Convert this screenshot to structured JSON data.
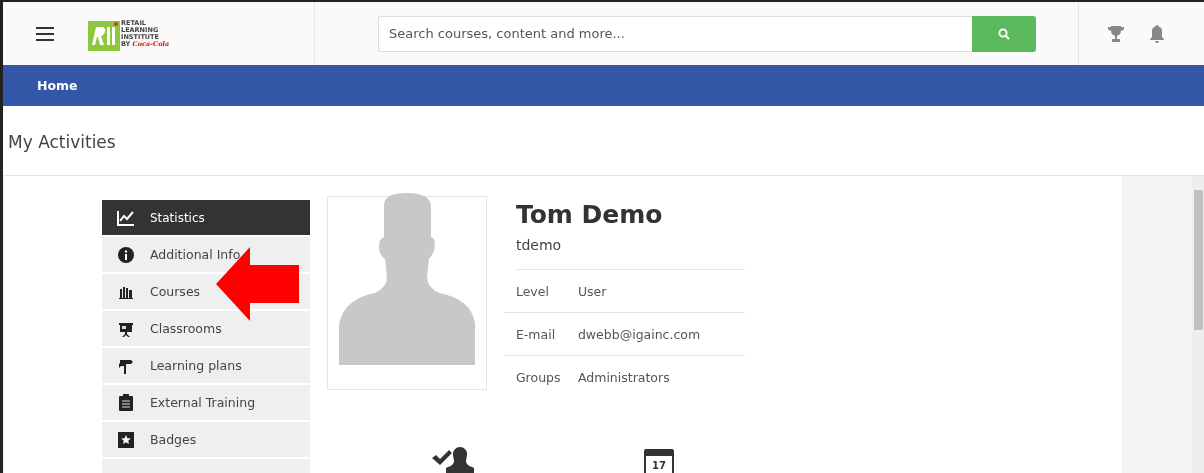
{
  "header": {
    "logo": {
      "lines": [
        "RETAIL",
        "LEARNING",
        "INSTITUTE"
      ],
      "by": "BY",
      "brand": "Coca-Cola"
    },
    "search": {
      "placeholder": "Search courses, content and more..."
    }
  },
  "nav": {
    "items": [
      {
        "label": "Home",
        "selected": true
      }
    ]
  },
  "page_title": "My Activities",
  "sidebar": {
    "items": [
      {
        "label": "Statistics",
        "kind": "chart",
        "selected": true
      },
      {
        "label": "Additional Info",
        "kind": "info",
        "selected": false
      },
      {
        "label": "Courses",
        "kind": "books",
        "selected": false
      },
      {
        "label": "Classrooms",
        "kind": "board",
        "selected": false
      },
      {
        "label": "Learning plans",
        "kind": "sign",
        "selected": false
      },
      {
        "label": "External Training",
        "kind": "clipboard",
        "selected": false
      },
      {
        "label": "Badges",
        "kind": "star",
        "selected": false
      }
    ]
  },
  "profile": {
    "name": "Tom Demo",
    "username": "tdemo",
    "fields": [
      {
        "label": "Level",
        "value": "User"
      },
      {
        "label": "E-mail",
        "value": "dwebb@igainc.com"
      },
      {
        "label": "Groups",
        "value": "Administrators"
      }
    ]
  },
  "calendar_day": "17"
}
